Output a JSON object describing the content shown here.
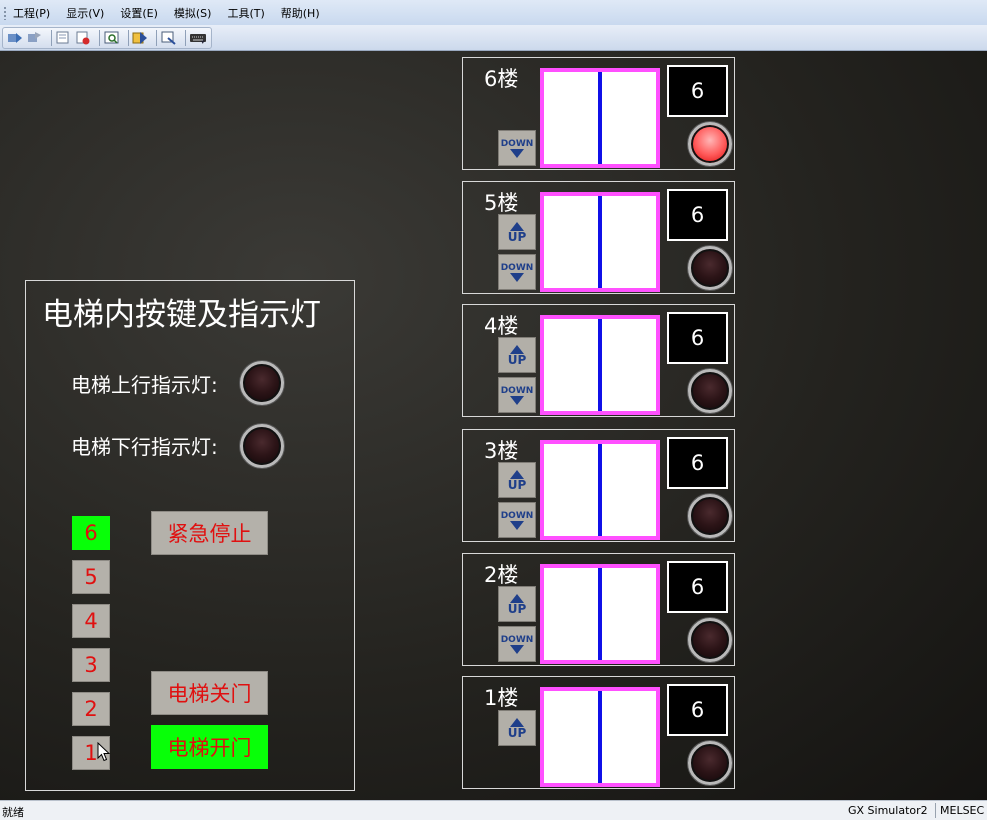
{
  "menu": [
    "工程(P)",
    "显示(V)",
    "设置(E)",
    "模拟(S)",
    "工具(T)",
    "帮助(H)"
  ],
  "toolbar": {
    "icons": [
      "start-icon",
      "stop-icon",
      "monitor-icon",
      "record-icon",
      "device-batch-icon",
      "timing-chart-icon",
      "io-system-icon",
      "keyboard-icon"
    ]
  },
  "car": {
    "title": "电梯内按键及指示灯",
    "up_label": "电梯上行指示灯:",
    "down_label": "电梯下行指示灯:",
    "up_lamp_on": false,
    "down_lamp_on": false,
    "floor_buttons": [
      "6",
      "5",
      "4",
      "3",
      "2",
      "1"
    ],
    "active_floor": "6",
    "emergency_stop": "紧急停止",
    "close_door": "电梯关门",
    "open_door": "电梯开门",
    "open_door_active": true
  },
  "floors": [
    {
      "label": "6楼",
      "display": "6",
      "has_up": false,
      "has_down": true,
      "lamp_on": true
    },
    {
      "label": "5楼",
      "display": "6",
      "has_up": true,
      "has_down": true,
      "lamp_on": false
    },
    {
      "label": "4楼",
      "display": "6",
      "has_up": true,
      "has_down": true,
      "lamp_on": false
    },
    {
      "label": "3楼",
      "display": "6",
      "has_up": true,
      "has_down": true,
      "lamp_on": false
    },
    {
      "label": "2楼",
      "display": "6",
      "has_up": true,
      "has_down": true,
      "lamp_on": false
    },
    {
      "label": "1楼",
      "display": "6",
      "has_up": true,
      "has_down": false,
      "lamp_on": false
    }
  ],
  "call_labels": {
    "up": "UP",
    "down": "DOWN"
  },
  "status": {
    "left": "就绪",
    "app": "GX Simulator2",
    "right": "MELSEC"
  },
  "colors": {
    "active_green": "#08ff08",
    "text_red": "#e01010",
    "door_frame": "#ff50ff",
    "door_seam": "#1010e8"
  }
}
